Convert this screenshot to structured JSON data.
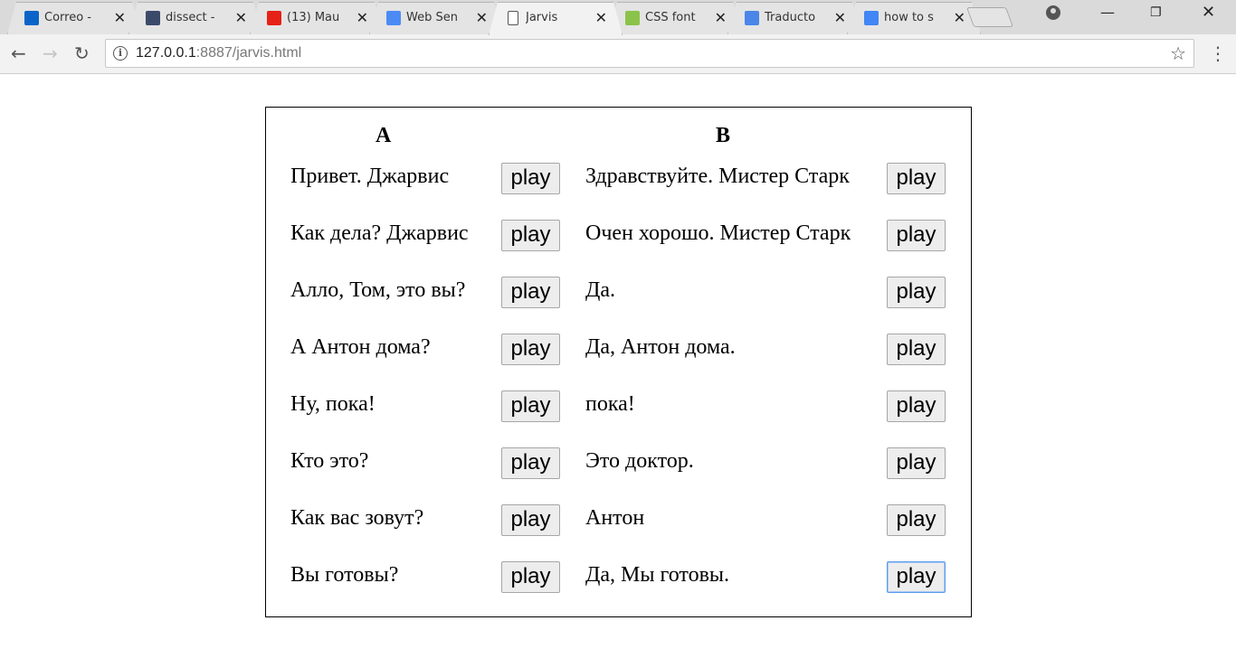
{
  "browser": {
    "tabs": [
      {
        "title": "Correo -",
        "favicon": "outlook-icon",
        "color": "#0a64c8"
      },
      {
        "title": "dissect -",
        "favicon": "latex-icon",
        "color": "#3c4a6a"
      },
      {
        "title": "(13) Mau",
        "favicon": "youtube-icon",
        "color": "#e62117"
      },
      {
        "title": "Web Sen",
        "favicon": "chrome-web-store-icon",
        "color": "#4c8bf5"
      },
      {
        "title": "Jarvis",
        "favicon": "page-icon",
        "color": "#ffffff"
      },
      {
        "title": "CSS font",
        "favicon": "w3schools-icon",
        "color": "#8bc34a"
      },
      {
        "title": "Traducto",
        "favicon": "google-translate-icon",
        "color": "#4a86e8"
      },
      {
        "title": "how to s",
        "favicon": "google-icon",
        "color": "#4285f4"
      }
    ],
    "active_tab": 4,
    "url_host": "127.0.0.1",
    "url_rest": ":8887/jarvis.html"
  },
  "page": {
    "col_a": "A",
    "col_b": "B",
    "play_label": "play",
    "rows": [
      {
        "a": "Привет. Джарвис",
        "b": "Здравствуйте. Мистер Старк"
      },
      {
        "a": "Как дела? Джарвис",
        "b": "Очен хорошо. Мистер Старк"
      },
      {
        "a": "Алло, Том, это вы?",
        "b": "Да."
      },
      {
        "a": "А Антон дома?",
        "b": "Да, Антон дома."
      },
      {
        "a": "Ну, пока!",
        "b": "пока!"
      },
      {
        "a": "Кто это?",
        "b": "Это доктор."
      },
      {
        "a": "Как вас зовут?",
        "b": "Антон"
      },
      {
        "a": "Вы готовы?",
        "b": "Да, Мы готовы."
      }
    ]
  }
}
